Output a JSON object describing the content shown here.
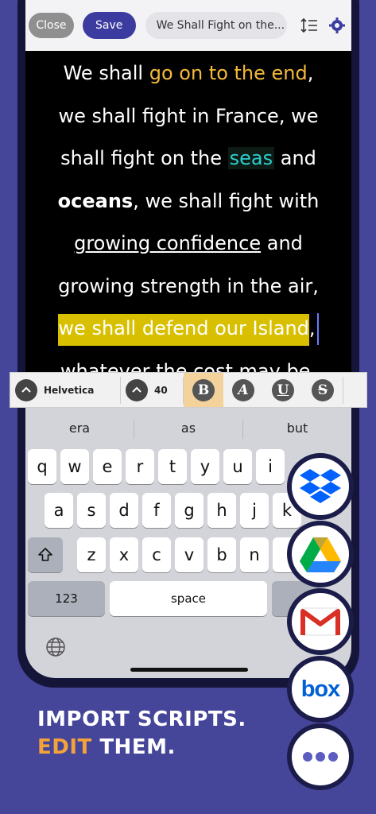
{
  "toolbar": {
    "close_label": "Close",
    "save_label": "Save",
    "script_title": "We Shall Fight on the..."
  },
  "script": {
    "l1_a": "We shall ",
    "l1_b": "go on to the end",
    "l1_c": ",",
    "l2": "we shall fight in France, we",
    "l3_a": "shall fight on the ",
    "l3_b": "seas",
    "l3_c": " and",
    "l4_a": "oceans",
    "l4_b": ", we shall fight with",
    "l5_a": "growing confidence",
    "l5_b": " and",
    "l6": "growing strength in the air,",
    "l7_a": "we shall defend our Island",
    "l7_b": ",",
    "l8": "whatever the cost may be,"
  },
  "format_bar": {
    "font_name": "Helvetica",
    "font_size": "40",
    "bold": "B",
    "italic": "A",
    "underline": "U",
    "strike": "S"
  },
  "keyboard": {
    "suggestions": [
      "era",
      "as",
      "but"
    ],
    "row1": [
      "q",
      "w",
      "e",
      "r",
      "t",
      "y",
      "u",
      "i"
    ],
    "row2": [
      "a",
      "s",
      "d",
      "f",
      "g",
      "h",
      "j",
      "k"
    ],
    "row3": [
      "z",
      "x",
      "c",
      "v",
      "b",
      "n"
    ],
    "numbers_label": "123",
    "space_label": "space"
  },
  "caption": {
    "line1": "IMPORT SCRIPTS.",
    "line2_accent": "EDIT",
    "line2_rest": " THEM."
  },
  "cloud": {
    "box_label": "box"
  },
  "colors": {
    "background": "#45459a",
    "accent_orange": "#f4a23a",
    "save_blue": "#3b3ba0",
    "highlight_yellow": "#d8c000",
    "teal": "#2ad0d0"
  },
  "icons": [
    "line-spacing-icon",
    "settings-icon",
    "chevron-up-icon",
    "shift-icon",
    "globe-icon",
    "dropbox-icon",
    "google-drive-icon",
    "gmail-icon",
    "box-icon",
    "more-icon"
  ]
}
